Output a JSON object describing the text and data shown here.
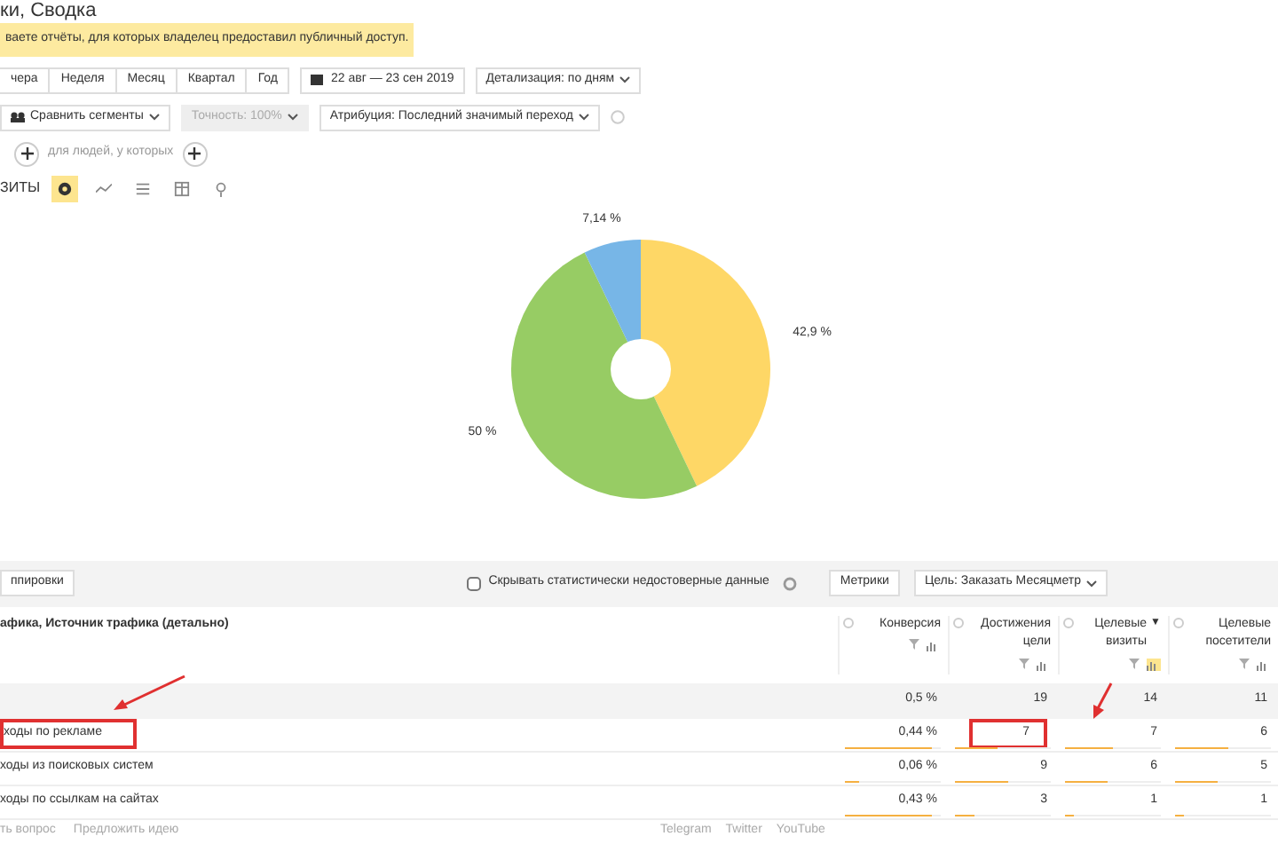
{
  "title": "ки, Сводка",
  "notice": "ваете отчёты, для которых владелец предоставил публичный доступ.",
  "periods": [
    {
      "label": "чера",
      "selected": false
    },
    {
      "label": "Неделя",
      "selected": false
    },
    {
      "label": "Месяц",
      "selected": false
    },
    {
      "label": "Квартал",
      "selected": false
    },
    {
      "label": "Год",
      "selected": false
    }
  ],
  "date_range": "22 авг — 23 сен 2019",
  "detail": "Детализация: по дням",
  "compare": "Сравнить сегменты",
  "accuracy": {
    "label": "Точность: 100%",
    "disabled": true
  },
  "attribution": "Атрибуция: Последний значимый переход",
  "segment_hint": "для людей, у которых",
  "chart_title": "ЗИТЫ",
  "chart_types": [
    {
      "kind": "pie",
      "selected": true
    },
    {
      "kind": "line",
      "selected": false
    },
    {
      "kind": "bars",
      "selected": false
    },
    {
      "kind": "table",
      "selected": false
    },
    {
      "kind": "map",
      "selected": false
    }
  ],
  "chart_data": {
    "type": "donut",
    "series": [
      {
        "values": [
          42.9,
          50,
          7.14
        ]
      }
    ],
    "colors": [
      "#fed766",
      "#97cc64",
      "#77b6e7"
    ],
    "value_labels": [
      "42,9 %",
      "50 %",
      "7,14 %"
    ]
  },
  "table_toolbar": {
    "groupings": "ппировки",
    "hide_unreliable": {
      "label": "Скрывать статистически недостоверные данные",
      "checked": false
    },
    "metrics": "Метрики",
    "goal": "Цель: Заказать Месяцметр"
  },
  "table": {
    "dimension_header": "афика, Источник трафика (детально)",
    "columns": [
      {
        "label": "Конверсия",
        "sorted": false
      },
      {
        "label": "Достижения цели",
        "sorted": false
      },
      {
        "label": "Целевые визиты",
        "sorted": true,
        "sort_mark": "▼"
      },
      {
        "label": "Целевые посетители",
        "sorted": false
      }
    ],
    "totals": [
      "0,5 %",
      "19",
      "14",
      "11"
    ],
    "rows": [
      {
        "name": "ходы по рекламе",
        "annotated": true,
        "cells": [
          {
            "value": "0,44 %",
            "level": 0.9,
            "annotated": false
          },
          {
            "value": "7",
            "level": 0.45,
            "annotated": true
          },
          {
            "value": "7",
            "level": 0.5,
            "annotated": false
          },
          {
            "value": "6",
            "level": 0.55,
            "annotated": false
          }
        ]
      },
      {
        "name": "ходы из поисковых систем",
        "annotated": false,
        "cells": [
          {
            "value": "0,06 %",
            "level": 0.15,
            "annotated": false
          },
          {
            "value": "9",
            "level": 0.55,
            "annotated": false
          },
          {
            "value": "6",
            "level": 0.45,
            "annotated": false
          },
          {
            "value": "5",
            "level": 0.45,
            "annotated": false
          }
        ]
      },
      {
        "name": "ходы по ссылкам на сайтах",
        "annotated": false,
        "cells": [
          {
            "value": "0,43 %",
            "level": 0.9,
            "annotated": false
          },
          {
            "value": "3",
            "level": 0.2,
            "annotated": false
          },
          {
            "value": "1",
            "level": 0.1,
            "annotated": false
          },
          {
            "value": "1",
            "level": 0.1,
            "annotated": false
          }
        ]
      }
    ]
  },
  "footer_left": [
    "ть вопрос",
    "Предложить идею"
  ],
  "footer_links": [
    "Telegram",
    "Twitter",
    "YouTube"
  ]
}
